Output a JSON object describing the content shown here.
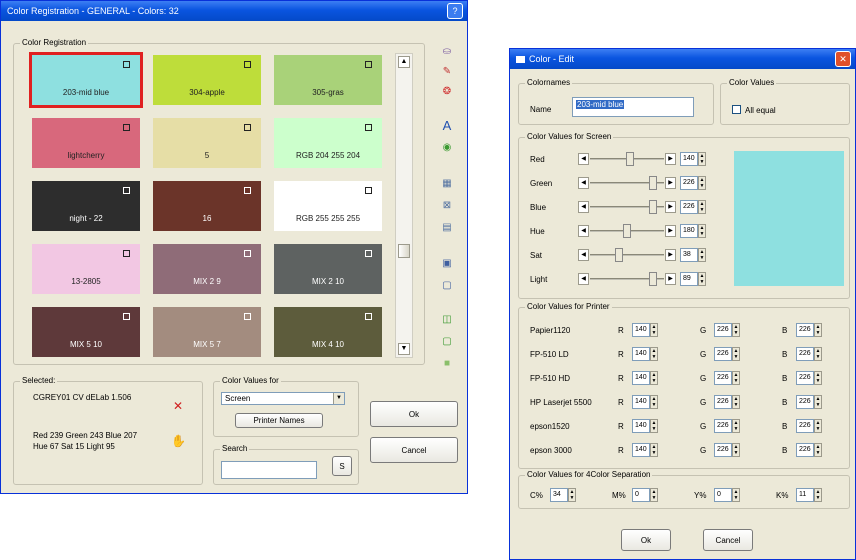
{
  "main_window": {
    "title": "Color Registration - GENERAL - Colors: 32",
    "group_label": "Color Registration",
    "tiles": [
      {
        "label": "203-mid blue",
        "bg": "#8ee0e0",
        "fg": "#222222",
        "selected": true
      },
      {
        "label": "304-apple",
        "bg": "#bedd3a",
        "fg": "#222222"
      },
      {
        "label": "305-gras",
        "bg": "#a9d279",
        "fg": "#222222"
      },
      {
        "label": "lightcherry",
        "bg": "#d8687c",
        "fg": "#222222"
      },
      {
        "label": "5",
        "bg": "#e6dea6",
        "fg": "#222222"
      },
      {
        "label": "RGB 204 255 204",
        "bg": "#ccffcc",
        "fg": "#222222"
      },
      {
        "label": "night - 22",
        "bg": "#2d2d2d",
        "fg": "#ffffff"
      },
      {
        "label": "16",
        "bg": "#6b3429",
        "fg": "#ffffff"
      },
      {
        "label": "RGB 255 255 255",
        "bg": "#ffffff",
        "fg": "#222222"
      },
      {
        "label": "13-2805",
        "bg": "#f2c7e3",
        "fg": "#222222"
      },
      {
        "label": "MIX 2 9",
        "bg": "#8f6c78",
        "fg": "#ffffff"
      },
      {
        "label": "MIX 2 10",
        "bg": "#5e6261",
        "fg": "#ffffff"
      },
      {
        "label": "MIX 5 10",
        "bg": "#5e393a",
        "fg": "#ffffff"
      },
      {
        "label": "MIX 5 7",
        "bg": "#a38c7f",
        "fg": "#ffffff"
      },
      {
        "label": "MIX 4 10",
        "bg": "#5d5c3c",
        "fg": "#ffffff"
      }
    ],
    "selected_group": "Selected:",
    "selected_line1": "CGREY01 CV dELab  1.506",
    "selected_line2": "Red 239 Green 243 Blue 207",
    "selected_line3": "Hue 67 Sat 15 Light 95",
    "color_values_for_label": "Color Values for",
    "color_values_for_value": "Screen",
    "printer_names_button": "Printer Names",
    "search_label": "Search",
    "search_value": "",
    "search_button": "S",
    "ok_button": "Ok",
    "cancel_button": "Cancel"
  },
  "edit_window": {
    "title": "Color - Edit",
    "colornames_label": "Colornames",
    "name_label": "Name",
    "name_value": "203-mid blue",
    "color_values_label": "Color Values",
    "all_equal_label": "All equal",
    "screen_group": "Color Values for Screen",
    "preview_color": "#8ee0e0",
    "screen_rows": [
      {
        "label": "Red",
        "value": "140",
        "level": 0.55
      },
      {
        "label": "Green",
        "value": "226",
        "level": 0.89
      },
      {
        "label": "Blue",
        "value": "226",
        "level": 0.89
      },
      {
        "label": "Hue",
        "value": "180",
        "level": 0.5
      },
      {
        "label": "Sat",
        "value": "38",
        "level": 0.38
      },
      {
        "label": "Light",
        "value": "89",
        "level": 0.89
      }
    ],
    "printer_group": "Color Values for Printer",
    "printer_rows": [
      {
        "name": "Papier1120",
        "r": "140",
        "g": "226",
        "b": "226"
      },
      {
        "name": "FP-510 LD",
        "r": "140",
        "g": "226",
        "b": "226"
      },
      {
        "name": "FP-510 HD",
        "r": "140",
        "g": "226",
        "b": "226"
      },
      {
        "name": "HP Laserjet 5500",
        "r": "140",
        "g": "226",
        "b": "226"
      },
      {
        "name": "epson1520",
        "r": "140",
        "g": "226",
        "b": "226"
      },
      {
        "name": "epson 3000",
        "r": "140",
        "g": "226",
        "b": "226"
      }
    ],
    "r_label": "R",
    "g_label": "G",
    "b_label": "B",
    "sep_group": "Color Values for 4Color Separation",
    "sep": [
      {
        "label": "C%",
        "value": "34"
      },
      {
        "label": "M%",
        "value": "0"
      },
      {
        "label": "Y%",
        "value": "0"
      },
      {
        "label": "K%",
        "value": "11"
      }
    ],
    "ok_button": "Ok",
    "cancel_button": "Cancel"
  }
}
